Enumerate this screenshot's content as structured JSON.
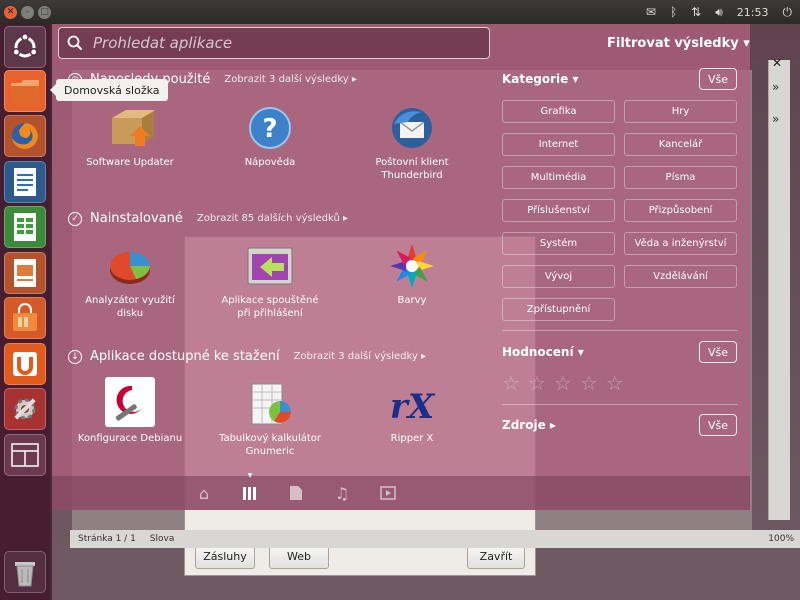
{
  "panel": {
    "clock": "21:53",
    "icons": [
      "close-window-icon",
      "minimize-window-icon",
      "maximize-window-icon",
      "mail-icon",
      "bluetooth-icon",
      "network-icon",
      "volume-icon",
      "power-icon"
    ]
  },
  "search": {
    "placeholder": "Prohledat aplikace"
  },
  "filter": {
    "title": "Filtrovat výsledky",
    "sections": {
      "categories": {
        "label": "Kategorie",
        "all": "Vše"
      },
      "rating": {
        "label": "Hodnocení",
        "all": "Vše"
      },
      "sources": {
        "label": "Zdroje",
        "all": "Vše"
      }
    },
    "categories": [
      "Grafika",
      "Hry",
      "Internet",
      "Kancelář",
      "Multimédia",
      "Písma",
      "Příslušenství",
      "Přizpůsobení",
      "Systém",
      "Věda a inženýrství",
      "Vývoj",
      "Vzdělávání",
      "Zpřístupnění"
    ]
  },
  "results": {
    "recent": {
      "title": "Naposledy použité",
      "more": "Zobrazit 3 další výsledky",
      "apps": [
        "Software Updater",
        "Nápověda",
        "Poštovní klient\nThunderbird"
      ]
    },
    "installed": {
      "title": "Nainstalované",
      "more": "Zobrazit 85 dalších výsledků",
      "apps": [
        "Analyzátor využití\ndisku",
        "Aplikace spouštěné\npři přihlášení",
        "Barvy"
      ]
    },
    "available": {
      "title": "Aplikace dostupné ke stažení",
      "more": "Zobrazit 3 další výsledky",
      "apps": [
        "Konfigurace Debianu",
        "Tabulkový kalkulátor\nGnumeric",
        "Ripper X"
      ]
    }
  },
  "launcher": {
    "tooltip": "Domovská složka"
  },
  "background": {
    "statusbar": [
      "Stránka 1 / 1",
      "Slova"
    ],
    "zoom": "100%",
    "dialog_buttons": [
      "Zásluhy",
      "Web",
      "Zavřít"
    ]
  }
}
